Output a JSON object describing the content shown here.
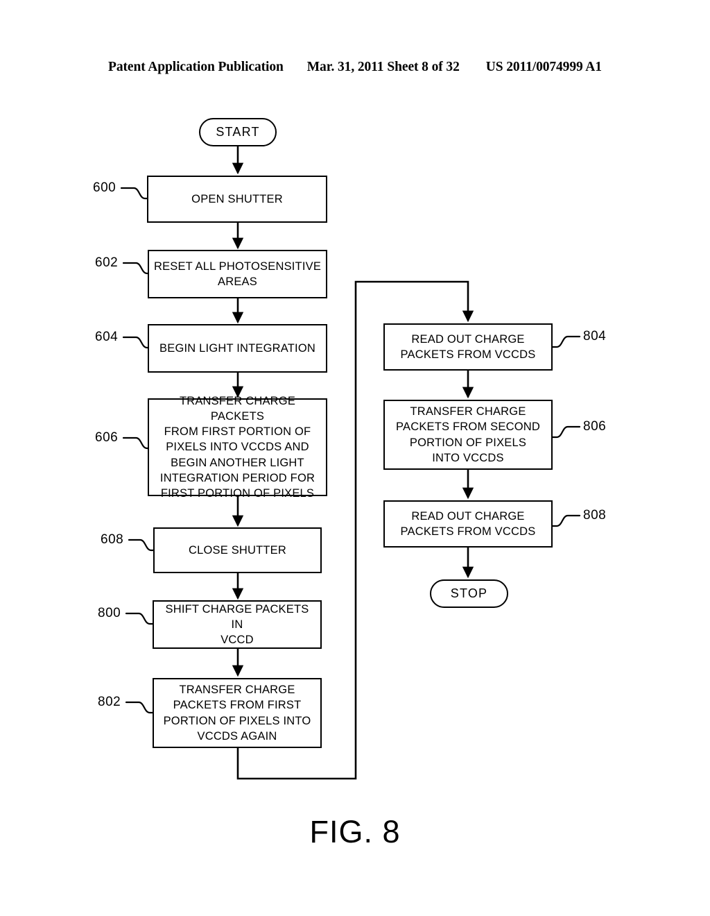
{
  "header": {
    "publication": "Patent Application Publication",
    "date": "Mar. 31, 2011",
    "sheet": "Sheet 8 of 32",
    "number": "US 2011/0074999 A1"
  },
  "figure": {
    "caption": "FIG. 8"
  },
  "flowchart": {
    "start_label": "START",
    "stop_label": "STOP",
    "nodes": [
      {
        "ref": "",
        "text": "START"
      },
      {
        "ref": "600",
        "text": "OPEN SHUTTER"
      },
      {
        "ref": "602",
        "text": "RESET ALL PHOTOSENSITIVE\nAREAS"
      },
      {
        "ref": "604",
        "text": "BEGIN LIGHT INTEGRATION"
      },
      {
        "ref": "606",
        "text": "TRANSFER CHARGE PACKETS\nFROM FIRST PORTION OF\nPIXELS INTO VCCDS AND\nBEGIN ANOTHER LIGHT\nINTEGRATION PERIOD FOR\nFIRST PORTION OF PIXELS"
      },
      {
        "ref": "608",
        "text": "CLOSE SHUTTER"
      },
      {
        "ref": "800",
        "text": "SHIFT CHARGE PACKETS IN\nVCCD"
      },
      {
        "ref": "802",
        "text": "TRANSFER CHARGE\nPACKETS FROM FIRST\nPORTION OF PIXELS INTO\nVCCDS AGAIN"
      },
      {
        "ref": "804",
        "text": "READ OUT CHARGE\nPACKETS FROM VCCDS"
      },
      {
        "ref": "806",
        "text": "TRANSFER CHARGE\nPACKETS FROM SECOND\nPORTION OF PIXELS\nINTO VCCDS"
      },
      {
        "ref": "808",
        "text": "READ OUT CHARGE\nPACKETS FROM VCCDS"
      },
      {
        "ref": "",
        "text": "STOP"
      }
    ],
    "refs": {
      "r600": "600",
      "r602": "602",
      "r604": "604",
      "r606": "606",
      "r608": "608",
      "r800": "800",
      "r802": "802",
      "r804": "804",
      "r806": "806",
      "r808": "808"
    },
    "steps": {
      "start": "START",
      "open_shutter": "OPEN SHUTTER",
      "reset_areas": "RESET ALL PHOTOSENSITIVE\nAREAS",
      "begin_integration": "BEGIN LIGHT INTEGRATION",
      "transfer_first": "TRANSFER CHARGE PACKETS\nFROM FIRST PORTION OF\nPIXELS INTO VCCDS AND\nBEGIN ANOTHER LIGHT\nINTEGRATION PERIOD FOR\nFIRST PORTION OF PIXELS",
      "close_shutter": "CLOSE SHUTTER",
      "shift_packets": "SHIFT CHARGE PACKETS IN\nVCCD",
      "transfer_first_again": "TRANSFER CHARGE\nPACKETS FROM FIRST\nPORTION OF PIXELS INTO\nVCCDS AGAIN",
      "readout_1": "READ OUT CHARGE\nPACKETS FROM VCCDS",
      "transfer_second": "TRANSFER CHARGE\nPACKETS FROM SECOND\nPORTION OF PIXELS\nINTO VCCDS",
      "readout_2": "READ OUT CHARGE\nPACKETS FROM VCCDS",
      "stop": "STOP"
    }
  },
  "colors": {
    "ink": "#000000",
    "paper": "#ffffff"
  }
}
